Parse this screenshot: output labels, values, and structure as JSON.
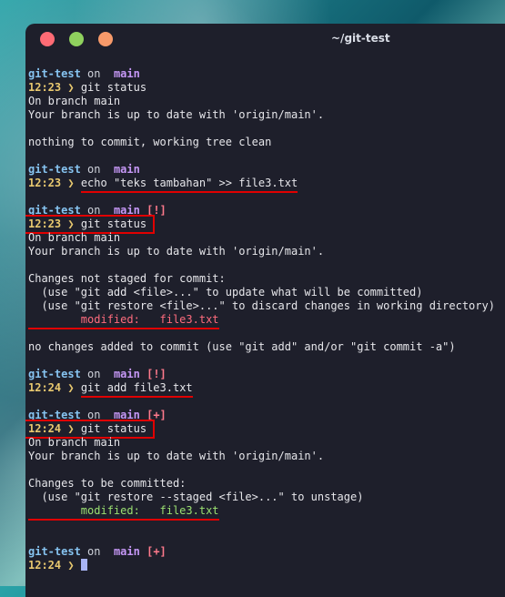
{
  "window": {
    "title": "~/git-test"
  },
  "prompt": {
    "dir": "git-test",
    "on": "on",
    "branch_icon": "",
    "branch": "main",
    "arrow": "❯"
  },
  "blocks": [
    {
      "flag": "",
      "time": "12:23",
      "cmd": "git status",
      "out": [
        "On branch main",
        "Your branch is up to date with 'origin/main'.",
        "",
        "nothing to commit, working tree clean"
      ]
    },
    {
      "flag": "",
      "time": "12:23",
      "cmd": "echo \"teks tambahan\" >> file3.txt"
    },
    {
      "flag": "[!]",
      "time": "12:23",
      "cmd": "git status",
      "out": [
        "On branch main",
        "Your branch is up to date with 'origin/main'.",
        "",
        "Changes not staged for commit:",
        "  (use \"git add <file>...\" to update what will be committed)",
        "  (use \"git restore <file>...\" to discard changes in working directory)"
      ],
      "modified": "        modified:   file3.txt",
      "after": [
        "",
        "no changes added to commit (use \"git add\" and/or \"git commit -a\")"
      ]
    },
    {
      "flag": "[!]",
      "time": "12:24",
      "cmd": "git add file3.txt"
    },
    {
      "flag": "[+]",
      "time": "12:24",
      "cmd": "git status",
      "out": [
        "On branch main",
        "Your branch is up to date with 'origin/main'.",
        "",
        "Changes to be committed:",
        "  (use \"git restore --staged <file>...\" to unstage)"
      ],
      "modified": "        modified:   file3.txt"
    },
    {
      "flag": "[+]",
      "time": "12:24",
      "cmd": ""
    }
  ],
  "colors": {
    "modified_unstaged": "#ff6c7e",
    "modified_staged": "#9be071",
    "highlight": "#e00000"
  }
}
